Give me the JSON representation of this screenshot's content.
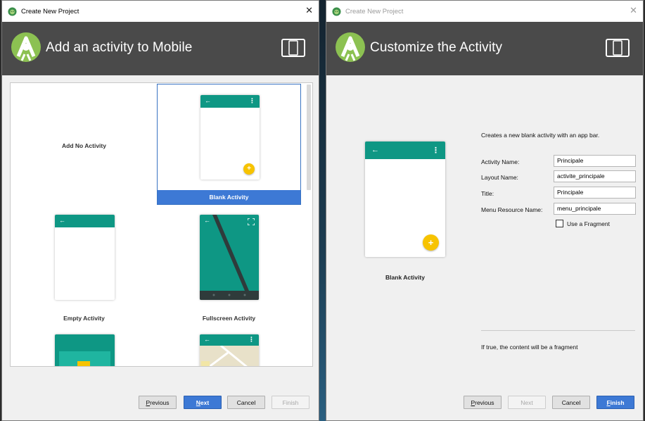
{
  "colors": {
    "header_bg": "#4a4a4a",
    "toolbar_teal": "#0e9784",
    "fab_yellow": "#f7c300",
    "accent_blue": "#3d79d5"
  },
  "left_window": {
    "title": "Create New Project",
    "close_glyph": "✕",
    "heading": "Add an activity to Mobile",
    "activities": [
      {
        "label": "Add No Activity"
      },
      {
        "label": "Blank Activity"
      },
      {
        "label": "Empty Activity"
      },
      {
        "label": "Fullscreen Activity"
      }
    ],
    "selected_activity": "Blank Activity",
    "buttons": {
      "previous": {
        "pre": "",
        "mnemonic": "P",
        "rest": "revious"
      },
      "next": {
        "pre": "",
        "mnemonic": "N",
        "rest": "ext"
      },
      "cancel": "Cancel",
      "finish": "Finish"
    }
  },
  "right_window": {
    "title": "Create New Project",
    "close_glyph": "✕",
    "heading": "Customize the Activity",
    "preview_label": "Blank Activity",
    "description": "Creates a new blank activity with an app bar.",
    "fields": {
      "activity_name": {
        "label": "Activity Name:",
        "value": "Principale"
      },
      "layout_name": {
        "label": "Layout Name:",
        "value": "activite_principale"
      },
      "title": {
        "label": "Title:",
        "value": "Principale"
      },
      "menu_resource_name": {
        "label": "Menu Resource Name:",
        "value": "menu_principale"
      }
    },
    "use_fragment": {
      "label": "Use a Fragment",
      "checked": false
    },
    "hint": "If true, the content will be a fragment",
    "buttons": {
      "previous": {
        "pre": "",
        "mnemonic": "P",
        "rest": "revious"
      },
      "next": "Next",
      "cancel": "Cancel",
      "finish": {
        "pre": "",
        "mnemonic": "F",
        "rest": "inish"
      }
    }
  }
}
